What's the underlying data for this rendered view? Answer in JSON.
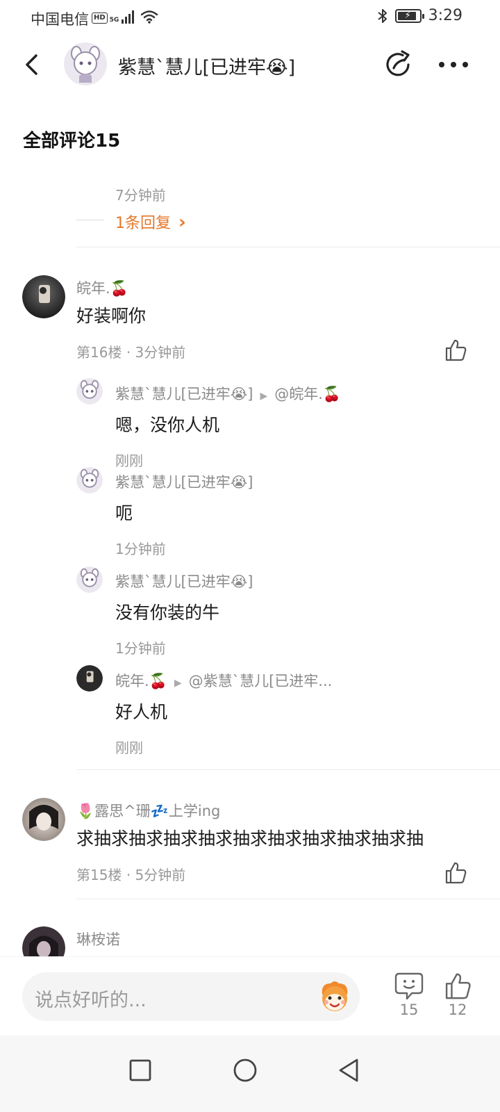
{
  "status_bar": {
    "carrier": "中国电信",
    "hd": "HD",
    "network": "5G",
    "time": "3:29"
  },
  "header": {
    "title": "紫慧`慧儿[已进牢😭]"
  },
  "comments_section": {
    "title": "全部评论15"
  },
  "prev_comment": {
    "time": "7分钟前",
    "replies_link": "1条回复",
    "replies_chevron": "›"
  },
  "comment_16": {
    "username": "皖年.🍒",
    "text": "好装啊你",
    "floor": "第16楼",
    "sep": "·",
    "time": "3分钟前",
    "replies": [
      {
        "username": "紫慧`慧儿[已进牢😭]",
        "reply_to": "@皖年.🍒",
        "text": "嗯，没你人机",
        "time": "刚刚"
      },
      {
        "username": "紫慧`慧儿[已进牢😭]",
        "reply_to": "",
        "text": "呃",
        "time": "1分钟前"
      },
      {
        "username": "紫慧`慧儿[已进牢😭]",
        "reply_to": "",
        "text": "没有你装的牛",
        "time": "1分钟前"
      },
      {
        "username": "皖年.🍒",
        "reply_to": "@紫慧`慧儿[已进牢...",
        "text": "好人机",
        "time": "刚刚"
      }
    ]
  },
  "comment_15": {
    "username": "🌷露思^珊💤上学ing",
    "text": "求抽求抽求抽求抽求抽求抽求抽求抽求抽求抽",
    "floor": "第15楼",
    "sep": "·",
    "time": "5分钟前"
  },
  "comment_14": {
    "username": "琳桉诺"
  },
  "bottom_bar": {
    "input_placeholder": "说点好听的...",
    "comment_count": "15",
    "like_count": "12"
  },
  "icons": {
    "back": "chevron-left-icon",
    "share": "share-icon",
    "more": "more-dots-icon",
    "like": "thumbs-up-icon",
    "comment": "comment-bubble-icon",
    "emoji": "emoji-sticker-icon",
    "nav_recent": "square-icon",
    "nav_home": "circle-icon",
    "nav_back": "triangle-back-icon"
  },
  "colors": {
    "accent": "#e5772a",
    "meta_text": "#999999",
    "name_text": "#8a8a8a",
    "input_bg": "#f4f4f4"
  }
}
